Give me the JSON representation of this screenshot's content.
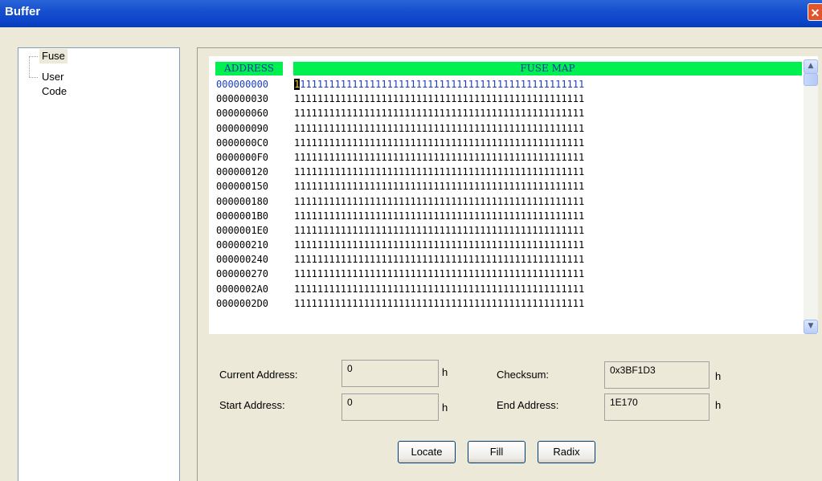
{
  "window": {
    "title": "Buffer",
    "close_glyph": "✕"
  },
  "tree": {
    "items": [
      {
        "label": "Fuse"
      },
      {
        "label": "User Code"
      }
    ]
  },
  "grid": {
    "col_address": "ADDRESS",
    "col_map": "FUSE MAP",
    "rows": [
      {
        "address": "000000000",
        "data": "11111111111111111111111111111111111111111111111111"
      },
      {
        "address": "000000030",
        "data": "11111111111111111111111111111111111111111111111111"
      },
      {
        "address": "000000060",
        "data": "11111111111111111111111111111111111111111111111111"
      },
      {
        "address": "000000090",
        "data": "11111111111111111111111111111111111111111111111111"
      },
      {
        "address": "0000000C0",
        "data": "11111111111111111111111111111111111111111111111111"
      },
      {
        "address": "0000000F0",
        "data": "11111111111111111111111111111111111111111111111111"
      },
      {
        "address": "000000120",
        "data": "11111111111111111111111111111111111111111111111111"
      },
      {
        "address": "000000150",
        "data": "11111111111111111111111111111111111111111111111111"
      },
      {
        "address": "000000180",
        "data": "11111111111111111111111111111111111111111111111111"
      },
      {
        "address": "0000001B0",
        "data": "11111111111111111111111111111111111111111111111111"
      },
      {
        "address": "0000001E0",
        "data": "11111111111111111111111111111111111111111111111111"
      },
      {
        "address": "000000210",
        "data": "11111111111111111111111111111111111111111111111111"
      },
      {
        "address": "000000240",
        "data": "11111111111111111111111111111111111111111111111111"
      },
      {
        "address": "000000270",
        "data": "11111111111111111111111111111111111111111111111111"
      },
      {
        "address": "0000002A0",
        "data": "11111111111111111111111111111111111111111111111111"
      },
      {
        "address": "0000002D0",
        "data": "11111111111111111111111111111111111111111111111111"
      }
    ],
    "scroll_up_glyph": "▲",
    "scroll_down_glyph": "▼"
  },
  "info": {
    "current_address_label": "Current Address:",
    "current_address_value": "0",
    "start_address_label": "Start Address:",
    "start_address_value": "0",
    "checksum_label": "Checksum:",
    "checksum_value": "0x3BF1D3",
    "end_address_label": "End Address:",
    "end_address_value": "1E170",
    "hex_suffix": "h"
  },
  "buttons": {
    "locate": "Locate",
    "fill": "Fill",
    "radix": "Radix"
  },
  "colors": {
    "header_bg": "#00f050",
    "header_text": "#1a33aa",
    "active_row": "#1a3fbf",
    "cursor_bg": "#000000",
    "cursor_text": "#ffd400"
  }
}
